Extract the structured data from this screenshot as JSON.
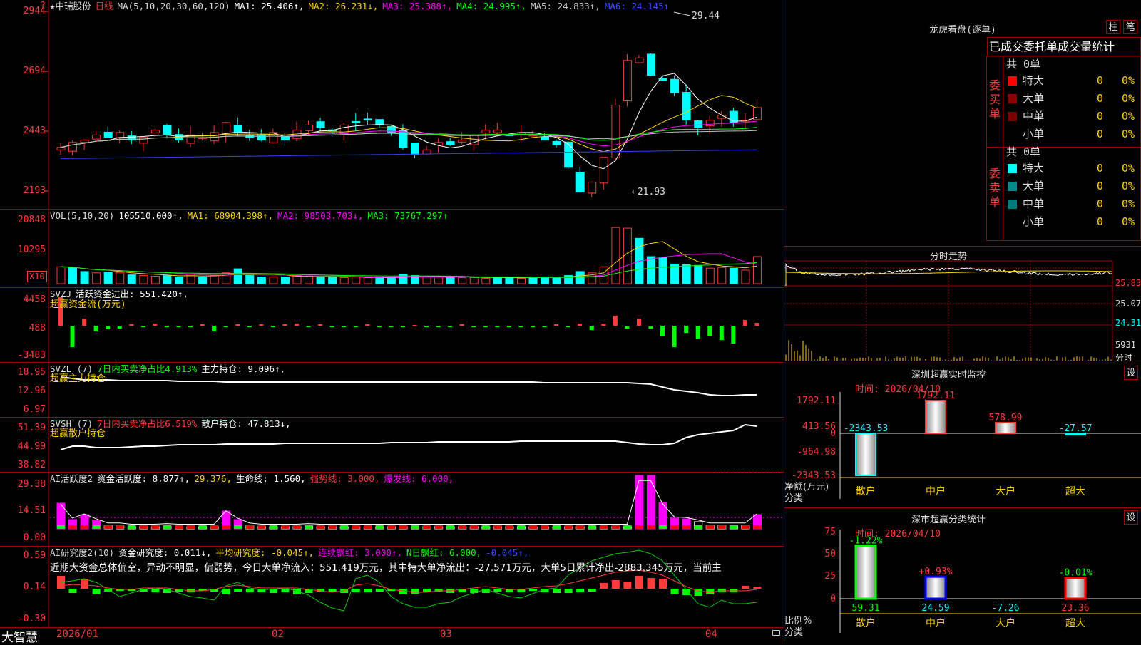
{
  "chart_header": {
    "marker": "?",
    "stock_name": "★中瑞股份",
    "period": "日线",
    "ma_def": "MA(5,10,20,30,60,120)",
    "ma1": "MA1: 25.406↑,",
    "ma2": "MA2: 26.231↓,",
    "ma3": "MA3: 25.388↑,",
    "ma4": "MA4: 24.995↑,",
    "ma5": "MA5: 24.833↑,",
    "ma6": "MA6: 24.145↑",
    "high_note": "29.44",
    "low_note": "←21.93"
  },
  "price_axis": [
    "2944",
    "2694",
    "2443",
    "2193"
  ],
  "vol_panel": {
    "def": "VOL(5,10,20)",
    "value": "105510.000↑,",
    "ma1": "MA1: 68904.398↑,",
    "ma2": "MA2: 98503.703↓,",
    "ma3": "MA3: 73767.297↑",
    "axis": [
      "20848",
      "10295"
    ],
    "unit": "X10"
  },
  "svzj_panel": {
    "def": "SVZJ",
    "text": "活跃资金进出: 551.420↑,",
    "sub": "超赢资金流(万元)",
    "axis": [
      "4458",
      "488",
      "-3483"
    ]
  },
  "svzl_panel": {
    "def": "SVZL (7)",
    "t1": "7日内买卖净占比4.913%",
    "t2": "主力持仓: 9.096↑,",
    "sub": "超赢主力持仓",
    "axis": [
      "18.95",
      "12.96",
      "6.97"
    ]
  },
  "svsh_panel": {
    "def": "SVSH (7)",
    "t1": "7日内买卖净占比6.519%",
    "t2": "散户持仓: 47.813↓,",
    "sub": "超赢散户持仓",
    "axis": [
      "51.39",
      "44.99",
      "38.82"
    ]
  },
  "ai1_panel": {
    "def": "AI活跃度2",
    "t1": "资金活跃度: 8.877↑,",
    "t2": "29.376,",
    "t3": "生命线: 1.560,",
    "t4": "强势线: 3.000,",
    "t5": "爆发线: 6.000,",
    "axis": [
      "29.38",
      "14.51",
      "0.00"
    ]
  },
  "ai2_panel": {
    "def": "AI研究度2(10)",
    "t1": "资金研究度: 0.011↓,",
    "t2": "平均研究度: -0.045↑,",
    "t3": "连续飘红: 3.000↑,",
    "t4": "N日飘红: 6.000,",
    "t5": "-0.045↑,",
    "comment": "近期大资金总体偏空，异动不明显，偏弱势，今日大单净流入：551.419万元，其中特大单净流出：-27.571万元，大单5日累计净出-2883.345万元，当前主",
    "axis": [
      "0.59",
      "0.14",
      "-0.30"
    ]
  },
  "footer": {
    "brand": "大智慧",
    "dates": [
      "2026/01",
      "02",
      "03",
      "04"
    ]
  },
  "dragon_panel": {
    "title": "龙虎看盘(逐单)",
    "btn1": "柱",
    "btn2": "笔",
    "tab": "已成交委托单成交量统计",
    "buy_label": "委买单",
    "sell_label": "委卖单",
    "buy_total": "共 0单",
    "sell_total": "共 0单",
    "buy_rows": [
      {
        "name": "特大",
        "num": "0",
        "pct": "0%",
        "color": "#ff0000"
      },
      {
        "name": "大单",
        "num": "0",
        "pct": "0%",
        "color": "#8b0000"
      },
      {
        "name": "中单",
        "num": "0",
        "pct": "0%",
        "color": "#7a0000"
      },
      {
        "name": "小单",
        "num": "0",
        "pct": "0%",
        "color": "#000000"
      }
    ],
    "sell_rows": [
      {
        "name": "特大",
        "num": "0",
        "pct": "0%",
        "color": "#00ffff"
      },
      {
        "name": "大单",
        "num": "0",
        "pct": "0%",
        "color": "#008b8b"
      },
      {
        "name": "中单",
        "num": "0",
        "pct": "0%",
        "color": "#007a7a"
      },
      {
        "name": "小单",
        "num": "0",
        "pct": "0%",
        "color": "#000000"
      }
    ]
  },
  "intraday_panel": {
    "title": "分时走势",
    "axis": [
      "25.83",
      "25.07",
      "24.31",
      "5931",
      "分时"
    ]
  },
  "sz_monitor": {
    "title": "深圳超赢实时监控",
    "btn": "设",
    "time": "时间: 2026/04/10",
    "axis": [
      "1792.11",
      "413.56",
      "0",
      "-964.98",
      "-2343.53"
    ],
    "ylabel1": "净额(万元)",
    "ylabel2": "分类",
    "categories": [
      "散户",
      "中户",
      "大户",
      "超大"
    ],
    "values": [
      -2343.53,
      1792.11,
      578.99,
      -27.57
    ],
    "value_labels": [
      "-2343.53",
      "1792.11",
      "578.99",
      "-27.57"
    ]
  },
  "sz_class": {
    "title": "深市超赢分类统计",
    "btn": "设",
    "time": "时间: 2026/04/10",
    "axis": [
      "75",
      "50",
      "25",
      "0"
    ],
    "ylabel1": "比例%",
    "ylabel2": "分类",
    "categories": [
      "散户",
      "中户",
      "大户",
      "超大"
    ],
    "values": [
      59.31,
      24.59,
      -7.26,
      23.36
    ],
    "value_labels": [
      "59.31",
      "24.59",
      "-7.26",
      "23.36"
    ],
    "pct_labels": [
      "-1.22%",
      "+0.93%",
      "",
      "-0.01%"
    ]
  },
  "colors": {
    "up": "#ff3b3b",
    "down": "#00ffff",
    "ma1": "#ffffff",
    "ma2": "#ffd400",
    "ma3": "#ff00ff",
    "ma4": "#00ff00",
    "ma5": "#c0c0c0",
    "ma6": "#3040ff"
  }
}
